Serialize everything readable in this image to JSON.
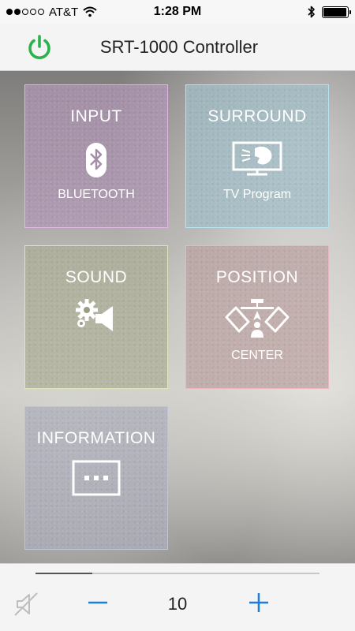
{
  "status_bar": {
    "carrier": "AT&T",
    "time": "1:28 PM",
    "signal_bars_filled": 2,
    "signal_bars_total": 5,
    "icons": [
      "wifi-icon",
      "bluetooth-icon",
      "battery-icon"
    ],
    "battery_level": 0.95
  },
  "nav": {
    "title": "SRT-1000 Controller",
    "power_icon": "power-icon",
    "power_color": "#2bb24c"
  },
  "tiles": {
    "input": {
      "title": "INPUT",
      "value": "BLUETOOTH",
      "icon": "bluetooth-icon"
    },
    "surround": {
      "title": "SURROUND",
      "value": "TV Program",
      "icon": "tv-program-icon"
    },
    "sound": {
      "title": "SOUND",
      "icon": "sound-settings-icon"
    },
    "position": {
      "title": "POSITION",
      "value": "CENTER",
      "icon": "speaker-position-icon"
    },
    "information": {
      "title": "INFORMATION",
      "icon": "more-icon"
    }
  },
  "volume": {
    "level": "10",
    "mute_icon": "mute-icon",
    "minus_icon": "minus-icon",
    "plus_icon": "plus-icon",
    "accent_color": "#1a7fe0",
    "slider_fraction": 0.2
  }
}
